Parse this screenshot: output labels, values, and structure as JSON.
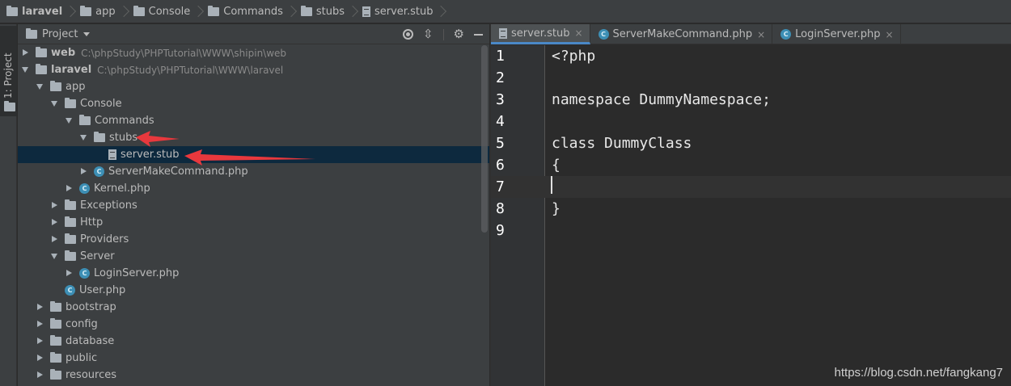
{
  "breadcrumb": [
    {
      "label": "laravel",
      "bold": true
    },
    {
      "label": "app"
    },
    {
      "label": "Console"
    },
    {
      "label": "Commands"
    },
    {
      "label": "stubs"
    },
    {
      "label": "server.stub",
      "file": true
    }
  ],
  "side_tab": {
    "label": "1: Project"
  },
  "project_panel": {
    "title": "Project",
    "tree": [
      {
        "label": "web",
        "path": "C:\\phpStudy\\PHPTutorial\\WWW\\shipin\\web",
        "bold": true,
        "indent": 0,
        "arrow": "right",
        "icon": "folder"
      },
      {
        "label": "laravel",
        "path": "C:\\phpStudy\\PHPTutorial\\WWW\\laravel",
        "bold": true,
        "indent": 0,
        "arrow": "down",
        "icon": "folder"
      },
      {
        "label": "app",
        "indent": 1,
        "arrow": "down",
        "icon": "folder"
      },
      {
        "label": "Console",
        "indent": 2,
        "arrow": "down",
        "icon": "folder"
      },
      {
        "label": "Commands",
        "indent": 3,
        "arrow": "down",
        "icon": "folder"
      },
      {
        "label": "stubs",
        "indent": 4,
        "arrow": "down",
        "icon": "folder"
      },
      {
        "label": "server.stub",
        "indent": 5,
        "arrow": "none",
        "icon": "file",
        "selected": true
      },
      {
        "label": "ServerMakeCommand.php",
        "indent": 4,
        "arrow": "right",
        "icon": "php"
      },
      {
        "label": "Kernel.php",
        "indent": 3,
        "arrow": "right",
        "icon": "php"
      },
      {
        "label": "Exceptions",
        "indent": 2,
        "arrow": "right",
        "icon": "folder"
      },
      {
        "label": "Http",
        "indent": 2,
        "arrow": "right",
        "icon": "folder"
      },
      {
        "label": "Providers",
        "indent": 2,
        "arrow": "right",
        "icon": "folder"
      },
      {
        "label": "Server",
        "indent": 2,
        "arrow": "down",
        "icon": "folder"
      },
      {
        "label": "LoginServer.php",
        "indent": 3,
        "arrow": "right",
        "icon": "php"
      },
      {
        "label": "User.php",
        "indent": 2,
        "arrow": "none",
        "icon": "php"
      },
      {
        "label": "bootstrap",
        "indent": 1,
        "arrow": "right",
        "icon": "folder"
      },
      {
        "label": "config",
        "indent": 1,
        "arrow": "right",
        "icon": "folder"
      },
      {
        "label": "database",
        "indent": 1,
        "arrow": "right",
        "icon": "folder"
      },
      {
        "label": "public",
        "indent": 1,
        "arrow": "right",
        "icon": "folder"
      },
      {
        "label": "resources",
        "indent": 1,
        "arrow": "right",
        "icon": "folder"
      }
    ]
  },
  "editor": {
    "tabs": [
      {
        "label": "server.stub",
        "icon": "file",
        "active": true
      },
      {
        "label": "ServerMakeCommand.php",
        "icon": "php"
      },
      {
        "label": "LoginServer.php",
        "icon": "php"
      }
    ],
    "lines": [
      {
        "n": "1",
        "text": "<?php"
      },
      {
        "n": "2",
        "text": ""
      },
      {
        "n": "3",
        "text": "namespace DummyNamespace;"
      },
      {
        "n": "4",
        "text": ""
      },
      {
        "n": "5",
        "text": "class DummyClass"
      },
      {
        "n": "6",
        "text": "{"
      },
      {
        "n": "7",
        "text": "",
        "current": true
      },
      {
        "n": "8",
        "text": "}"
      },
      {
        "n": "9",
        "text": ""
      }
    ]
  },
  "php_icon_letter": "C",
  "close_glyph": "×",
  "watermark": "https://blog.csdn.net/fangkang7",
  "colors": {
    "accent": "#4a88c7",
    "selection": "#0d293e",
    "annotation": "#e8383d"
  }
}
